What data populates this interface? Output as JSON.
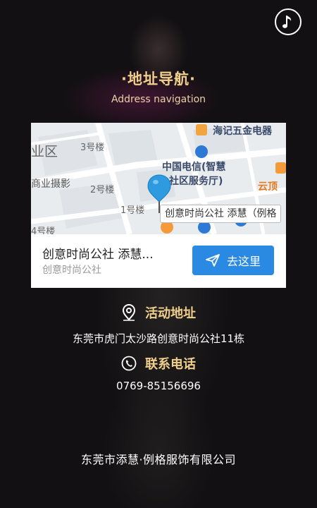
{
  "header": {
    "title": "·地址导航·",
    "subtitle": "Address navigation"
  },
  "map": {
    "labels": {
      "district": "业区",
      "building3": "3号楼",
      "building2": "2号楼",
      "building1": "1号楼",
      "building4": "4号楼",
      "photo": "商业摄影",
      "hardware": "海记五金电器",
      "telecom_line1": "中国电信(智慧",
      "telecom_line2": "社区服务厅)",
      "yunding": "云顶",
      "callout": "创意时尚公社 添慧（例格"
    }
  },
  "place": {
    "name": "创意时尚公社 添慧...",
    "sub": "创意时尚公社",
    "go_label": "去这里"
  },
  "address": {
    "heading": "活动地址",
    "value": "东莞市虎门太沙路创意时尚公社11栋"
  },
  "phone": {
    "heading": "联系电话",
    "value": "0769-85156696"
  },
  "footer": {
    "company": "东莞市添慧·例格服饰有限公司"
  },
  "colors": {
    "gold": "#f0cf8a",
    "button_blue": "#2a8ae3",
    "pin_blue": "#2e9be0"
  }
}
